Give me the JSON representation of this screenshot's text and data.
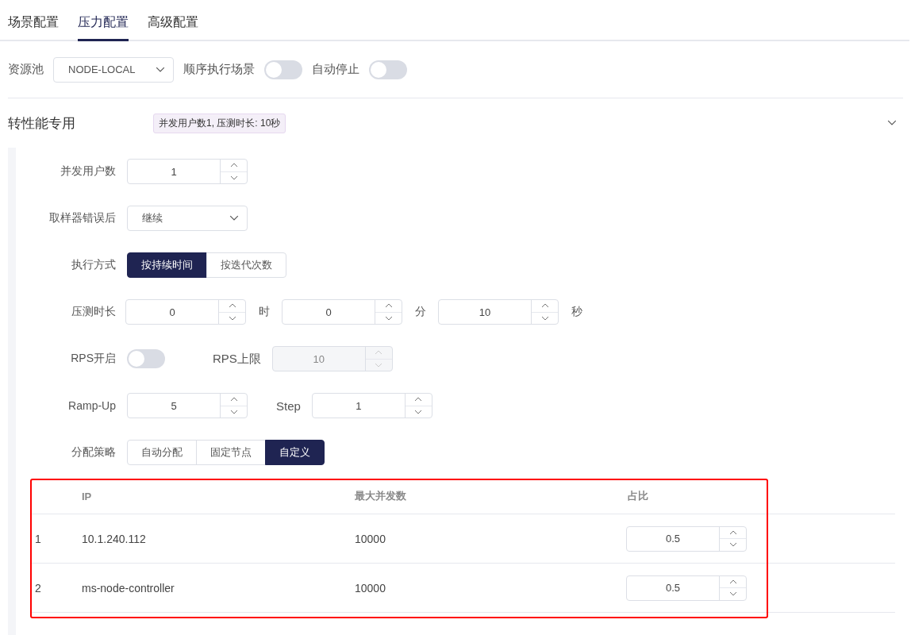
{
  "tabs": [
    {
      "label": "场景配置",
      "selected": false
    },
    {
      "label": "压力配置",
      "selected": true
    },
    {
      "label": "高级配置",
      "selected": false
    }
  ],
  "resource_pool": {
    "label": "资源池",
    "value": "NODE-LOCAL"
  },
  "toggles": [
    {
      "label": "顺序执行场景",
      "on": false
    },
    {
      "label": "自动停止",
      "on": false
    }
  ],
  "section": {
    "title": "转性能专用",
    "summary": "并发用户数1, 压测时长: 10秒",
    "expanded": true
  },
  "concurrent_users": {
    "label": "并发用户数",
    "value": "1"
  },
  "on_sampler_error": {
    "label": "取样器错误后",
    "value": "继续"
  },
  "execution_mode": {
    "label": "执行方式",
    "options": [
      {
        "label": "按持续时间",
        "selected": true
      },
      {
        "label": "按迭代次数",
        "selected": false
      }
    ]
  },
  "duration": {
    "label": "压测时长",
    "parts": [
      {
        "value": "0",
        "unit": "时"
      },
      {
        "value": "0",
        "unit": "分"
      },
      {
        "value": "10",
        "unit": "秒"
      }
    ]
  },
  "rps": {
    "label": "RPS开启",
    "on": false,
    "limit_label": "RPS上限",
    "limit_value": "10",
    "limit_disabled": true
  },
  "ramp_up": {
    "label": "Ramp-Up",
    "value": "5",
    "step_label": "Step",
    "step_value": "1"
  },
  "allocation": {
    "label": "分配策略",
    "options": [
      {
        "label": "自动分配",
        "selected": false
      },
      {
        "label": "固定节点",
        "selected": false
      },
      {
        "label": "自定义",
        "selected": true
      }
    ]
  },
  "table": {
    "columns": [
      "IP",
      "最大并发数",
      "占比"
    ],
    "rows": [
      {
        "index": "1",
        "ip": "10.1.240.112",
        "max": "10000",
        "ratio": "0.5"
      },
      {
        "index": "2",
        "ip": "ms-node-controller",
        "max": "10000",
        "ratio": "0.5"
      }
    ]
  }
}
